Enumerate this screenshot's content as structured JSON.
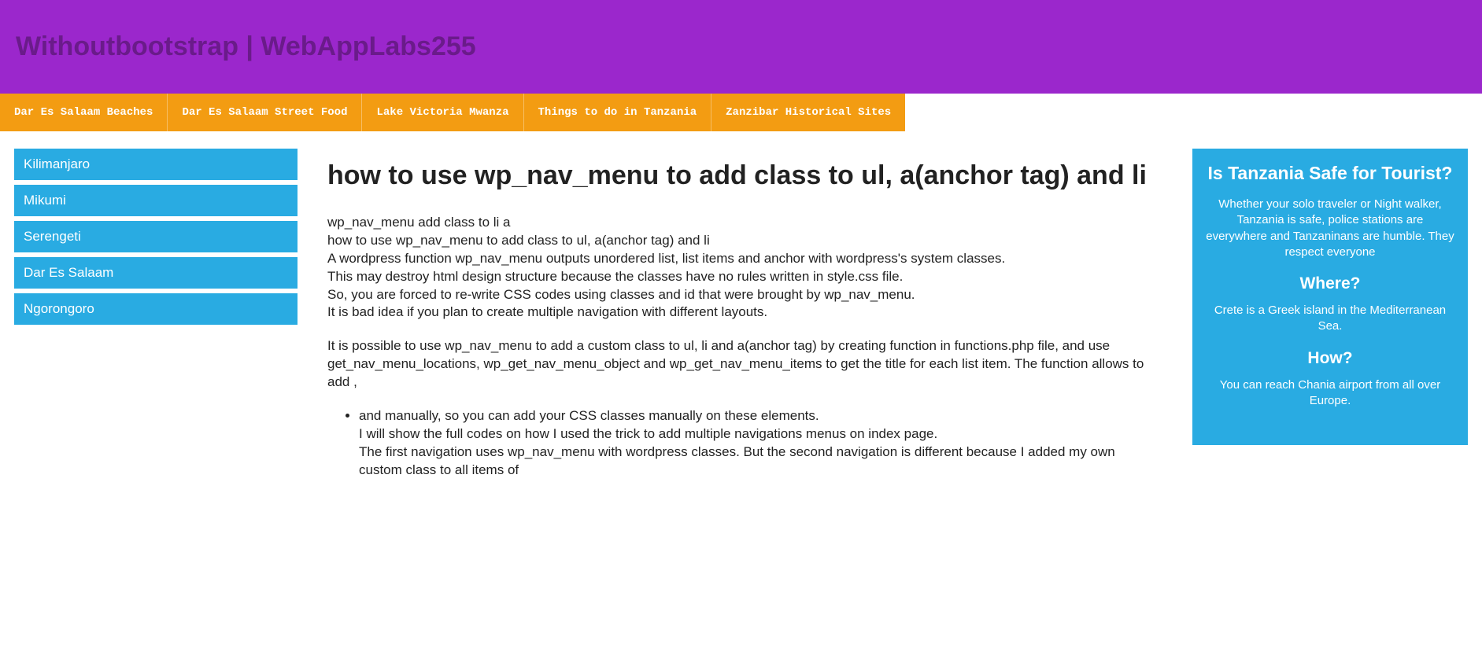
{
  "header": {
    "title": "Withoutbootstrap | WebAppLabs255"
  },
  "topnav": [
    "Dar Es Salaam Beaches",
    "Dar Es Salaam Street Food",
    "Lake Victoria Mwanza",
    "Things to do in Tanzania",
    "Zanzibar Historical Sites"
  ],
  "sidebar": [
    "Kilimanjaro",
    "Mikumi",
    "Serengeti",
    "Dar Es Salaam",
    "Ngorongoro"
  ],
  "article": {
    "title": "how to use wp_nav_menu to add class to ul, a(anchor tag) and li",
    "para1": "wp_nav_menu add class to li a\nhow to use wp_nav_menu to add class to ul, a(anchor tag) and li\nA wordpress function wp_nav_menu outputs unordered list, list items and anchor with wordpress's system classes.\nThis may destroy html design structure because the classes have no rules written in style.css file.\nSo, you are forced to re-write CSS codes using classes and id that were brought by wp_nav_menu.\nIt is bad idea if you plan to create multiple navigation with different layouts.",
    "para2": "It is possible to use wp_nav_menu to add a custom class to ul, li and a(anchor tag) by creating function in functions.php file, and use get_nav_menu_locations, wp_get_nav_menu_object and wp_get_nav_menu_items to get the title for each list item. The function allows to add ,",
    "bullet1": "and manually, so you can add your CSS classes manually on these elements.\nI will show the full codes on how I used the trick to add multiple navigations menus on index page.\nThe first navigation uses wp_nav_menu with wordpress classes. But the second navigation is different because I added my own custom class to all items of"
  },
  "rightcol": {
    "h1": "Is Tanzania Safe for Tourist?",
    "p1": "Whether your solo traveler or Night walker, Tanzania is safe, police stations are everywhere and Tanzaninans are humble. They respect everyone",
    "h2": "Where?",
    "p2": "Crete is a Greek island in the Mediterranean Sea.",
    "h3": "How?",
    "p3": "You can reach Chania airport from all over Europe."
  }
}
